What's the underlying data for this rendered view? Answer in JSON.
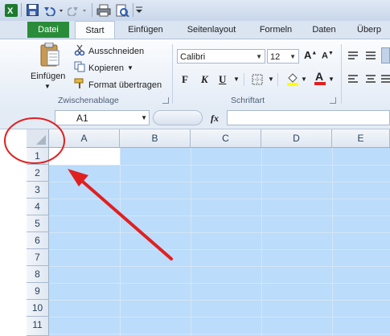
{
  "ribbon_tabs": [
    {
      "label": "Datei"
    },
    {
      "label": "Start"
    },
    {
      "label": "Einfügen"
    },
    {
      "label": "Seitenlayout"
    },
    {
      "label": "Formeln"
    },
    {
      "label": "Daten"
    },
    {
      "label": "Überp"
    }
  ],
  "clipboard": {
    "paste_label": "Einfügen",
    "cut_label": "Ausschneiden",
    "copy_label": "Kopieren",
    "format_painter_label": "Format übertragen",
    "group_label": "Zwischenablage"
  },
  "font": {
    "font_name": "Calibri",
    "font_size": "12",
    "bold": "F",
    "italic": "K",
    "underline": "U",
    "group_label": "Schriftart"
  },
  "formula_bar": {
    "name_box": "A1",
    "fx": "fx"
  },
  "grid": {
    "columns": [
      "A",
      "B",
      "C",
      "D",
      "E"
    ],
    "rows": [
      "1",
      "2",
      "3",
      "4",
      "5",
      "6",
      "7",
      "8",
      "9",
      "10",
      "11"
    ]
  },
  "annotation": {
    "color": "#e02020"
  }
}
